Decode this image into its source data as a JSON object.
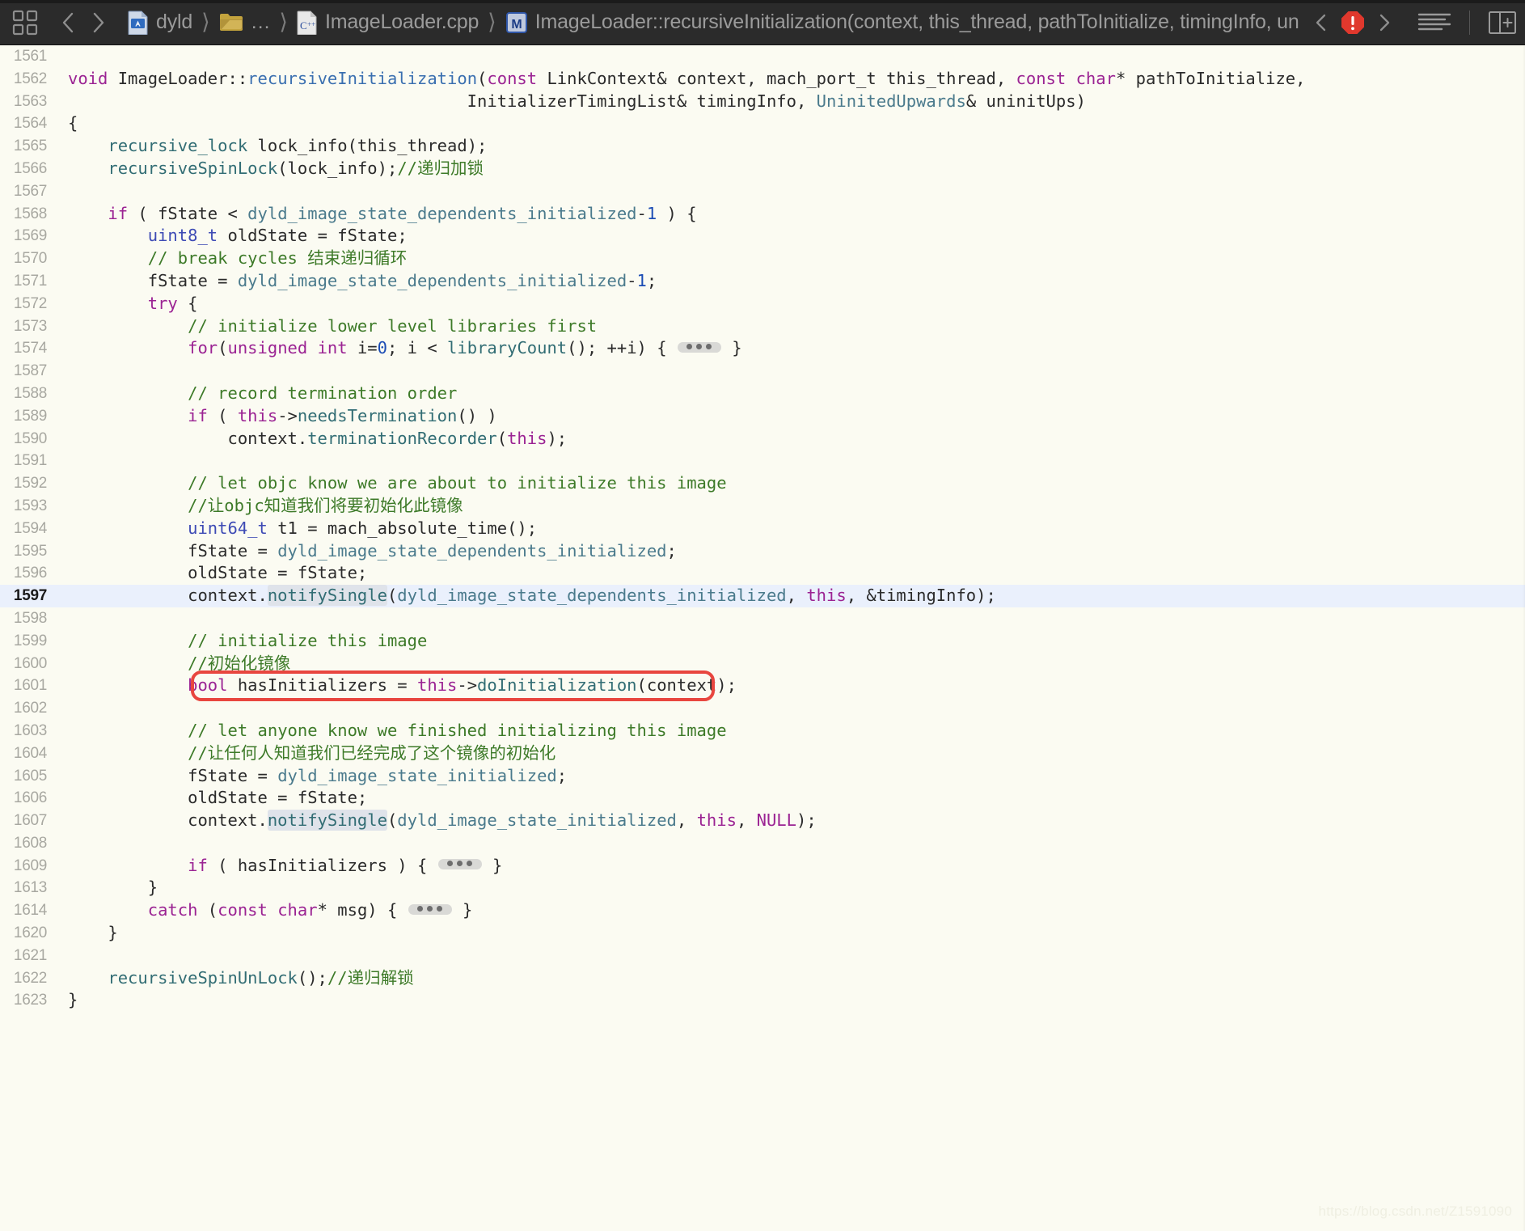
{
  "window": {
    "app": "Xcode",
    "background": "#fbfbf2",
    "toolbar_background": "#2b2b2b",
    "highlight_line_color": "#eaf0fc",
    "annotation_box_color": "#e8463f"
  },
  "toolbar": {
    "grid_icon": "grid-icon",
    "back_label": "‹",
    "forward_label": "›",
    "breadcrumb": [
      {
        "icon": "project-document-icon",
        "label": "dyld"
      },
      {
        "icon": "folder-icon",
        "label": "…"
      },
      {
        "icon": "cpp-source-file-icon",
        "label": "ImageLoader.cpp"
      },
      {
        "icon": "method-symbol-icon",
        "label": "ImageLoader::recursiveInitialization(context, this_thread, pathToInitialize, timingInfo, uninitUps)"
      }
    ],
    "issue_prev_label": "‹",
    "issue_next_label": "›",
    "issue_badge": "error-stop-icon",
    "minimap_icon": "document-lines-icon",
    "assistant_icon": "split-editor-icon"
  },
  "editor": {
    "selected_symbol": "notifySingle",
    "highlighted_line": "1597",
    "annotated_line": "1601",
    "lines": [
      {
        "n": "1561",
        "tokens": []
      },
      {
        "n": "1562",
        "tokens": [
          {
            "t": "void",
            "c": "t-kw"
          },
          {
            "t": " ImageLoader::",
            "c": "t-dark"
          },
          {
            "t": "recursiveInitialization",
            "c": "t-fndef"
          },
          {
            "t": "(",
            "c": "t-dark"
          },
          {
            "t": "const",
            "c": "t-kw"
          },
          {
            "t": " LinkContext& context, mach_port_t this_thread, ",
            "c": "t-dark"
          },
          {
            "t": "const",
            "c": "t-kw"
          },
          {
            "t": " ",
            "c": "t-dark"
          },
          {
            "t": "char",
            "c": "t-kw"
          },
          {
            "t": "* pathToInitialize,",
            "c": "t-dark"
          }
        ]
      },
      {
        "n": "1563",
        "tokens": [
          {
            "t": "                                        InitializerTimingList",
            "c": "t-dark"
          },
          {
            "t": "& timingInfo, ",
            "c": "t-dark"
          },
          {
            "t": "UninitedUpwards",
            "c": "t-const"
          },
          {
            "t": "& uninitUps)",
            "c": "t-dark"
          }
        ]
      },
      {
        "n": "1564",
        "tokens": [
          {
            "t": "{",
            "c": "t-dark"
          }
        ]
      },
      {
        "n": "1565",
        "tokens": [
          {
            "t": "    ",
            "c": "t-dark"
          },
          {
            "t": "recursive_lock",
            "c": "t-fn"
          },
          {
            "t": " lock_info(this_thread);",
            "c": "t-dark"
          }
        ]
      },
      {
        "n": "1566",
        "tokens": [
          {
            "t": "    ",
            "c": "t-dark"
          },
          {
            "t": "recursiveSpinLock",
            "c": "t-fn"
          },
          {
            "t": "(lock_info);",
            "c": "t-dark"
          },
          {
            "t": "//递归加锁",
            "c": "t-cmt"
          }
        ]
      },
      {
        "n": "1567",
        "tokens": []
      },
      {
        "n": "1568",
        "tokens": [
          {
            "t": "    ",
            "c": "t-dark"
          },
          {
            "t": "if",
            "c": "t-kw"
          },
          {
            "t": " ( fState < ",
            "c": "t-dark"
          },
          {
            "t": "dyld_image_state_dependents_initialized",
            "c": "t-const"
          },
          {
            "t": "-",
            "c": "t-dark"
          },
          {
            "t": "1",
            "c": "t-num"
          },
          {
            "t": " ) {",
            "c": "t-dark"
          }
        ]
      },
      {
        "n": "1569",
        "tokens": [
          {
            "t": "        ",
            "c": "t-dark"
          },
          {
            "t": "uint8_t",
            "c": "t-type"
          },
          {
            "t": " oldState = fState;",
            "c": "t-dark"
          }
        ]
      },
      {
        "n": "1570",
        "tokens": [
          {
            "t": "        ",
            "c": "t-dark"
          },
          {
            "t": "// break cycles 结束递归循环",
            "c": "t-cmt"
          }
        ]
      },
      {
        "n": "1571",
        "tokens": [
          {
            "t": "        fState = ",
            "c": "t-dark"
          },
          {
            "t": "dyld_image_state_dependents_initialized",
            "c": "t-const"
          },
          {
            "t": "-",
            "c": "t-dark"
          },
          {
            "t": "1",
            "c": "t-num"
          },
          {
            "t": ";",
            "c": "t-dark"
          }
        ]
      },
      {
        "n": "1572",
        "tokens": [
          {
            "t": "        ",
            "c": "t-dark"
          },
          {
            "t": "try",
            "c": "t-kw"
          },
          {
            "t": " {",
            "c": "t-dark"
          }
        ]
      },
      {
        "n": "1573",
        "tokens": [
          {
            "t": "            ",
            "c": "t-dark"
          },
          {
            "t": "// initialize lower level libraries first",
            "c": "t-cmt"
          }
        ]
      },
      {
        "n": "1574",
        "tokens": [
          {
            "t": "            ",
            "c": "t-dark"
          },
          {
            "t": "for",
            "c": "t-kw"
          },
          {
            "t": "(",
            "c": "t-dark"
          },
          {
            "t": "unsigned",
            "c": "t-kw"
          },
          {
            "t": " ",
            "c": "t-dark"
          },
          {
            "t": "int",
            "c": "t-kw"
          },
          {
            "t": " i=",
            "c": "t-dark"
          },
          {
            "t": "0",
            "c": "t-num"
          },
          {
            "t": "; i < ",
            "c": "t-dark"
          },
          {
            "t": "libraryCount",
            "c": "t-fn"
          },
          {
            "t": "(); ++i) { ",
            "c": "t-dark"
          },
          {
            "t": "…FOLD…",
            "c": "fold"
          },
          {
            "t": " }",
            "c": "t-dark"
          }
        ]
      },
      {
        "n": "1587",
        "tokens": []
      },
      {
        "n": "1588",
        "tokens": [
          {
            "t": "            ",
            "c": "t-dark"
          },
          {
            "t": "// record termination order",
            "c": "t-cmt"
          }
        ]
      },
      {
        "n": "1589",
        "tokens": [
          {
            "t": "            ",
            "c": "t-dark"
          },
          {
            "t": "if",
            "c": "t-kw"
          },
          {
            "t": " ( ",
            "c": "t-dark"
          },
          {
            "t": "this",
            "c": "t-kw"
          },
          {
            "t": "->",
            "c": "t-dark"
          },
          {
            "t": "needsTermination",
            "c": "t-fn"
          },
          {
            "t": "() )",
            "c": "t-dark"
          }
        ]
      },
      {
        "n": "1590",
        "tokens": [
          {
            "t": "                context.",
            "c": "t-dark"
          },
          {
            "t": "terminationRecorder",
            "c": "t-fn"
          },
          {
            "t": "(",
            "c": "t-dark"
          },
          {
            "t": "this",
            "c": "t-kw"
          },
          {
            "t": ");",
            "c": "t-dark"
          }
        ]
      },
      {
        "n": "1591",
        "tokens": []
      },
      {
        "n": "1592",
        "tokens": [
          {
            "t": "            ",
            "c": "t-dark"
          },
          {
            "t": "// let objc know we are about to initialize this image",
            "c": "t-cmt"
          }
        ]
      },
      {
        "n": "1593",
        "tokens": [
          {
            "t": "            ",
            "c": "t-dark"
          },
          {
            "t": "//让objc知道我们将要初始化此镜像",
            "c": "t-cmt"
          }
        ]
      },
      {
        "n": "1594",
        "tokens": [
          {
            "t": "            ",
            "c": "t-dark"
          },
          {
            "t": "uint64_t",
            "c": "t-type"
          },
          {
            "t": " t1 = mach_absolute_time();",
            "c": "t-dark"
          }
        ]
      },
      {
        "n": "1595",
        "tokens": [
          {
            "t": "            fState = ",
            "c": "t-dark"
          },
          {
            "t": "dyld_image_state_dependents_initialized",
            "c": "t-const"
          },
          {
            "t": ";",
            "c": "t-dark"
          }
        ]
      },
      {
        "n": "1596",
        "tokens": [
          {
            "t": "            oldState = fState;",
            "c": "t-dark"
          }
        ]
      },
      {
        "n": "1597",
        "hl": true,
        "tokens": [
          {
            "t": "            context.",
            "c": "t-dark"
          },
          {
            "t": "notifySingle",
            "c": "t-fn t-sel"
          },
          {
            "t": "(",
            "c": "t-dark"
          },
          {
            "t": "dyld_image_state_dependents_initialized",
            "c": "t-const"
          },
          {
            "t": ", ",
            "c": "t-dark"
          },
          {
            "t": "this",
            "c": "t-kw"
          },
          {
            "t": ", &timingInfo);",
            "c": "t-dark"
          }
        ]
      },
      {
        "n": "1598",
        "tokens": []
      },
      {
        "n": "1599",
        "tokens": [
          {
            "t": "            ",
            "c": "t-dark"
          },
          {
            "t": "// initialize this image",
            "c": "t-cmt"
          }
        ]
      },
      {
        "n": "1600",
        "tokens": [
          {
            "t": "            ",
            "c": "t-dark"
          },
          {
            "t": "//初始化镜像",
            "c": "t-cmt"
          }
        ]
      },
      {
        "n": "1601",
        "box": true,
        "tokens": [
          {
            "t": "            ",
            "c": "t-dark"
          },
          {
            "t": "bool",
            "c": "t-kw"
          },
          {
            "t": " hasInitializers = ",
            "c": "t-dark"
          },
          {
            "t": "this",
            "c": "t-kw"
          },
          {
            "t": "->",
            "c": "t-dark"
          },
          {
            "t": "doInitialization",
            "c": "t-fn"
          },
          {
            "t": "(context);",
            "c": "t-dark"
          }
        ]
      },
      {
        "n": "1602",
        "tokens": []
      },
      {
        "n": "1603",
        "tokens": [
          {
            "t": "            ",
            "c": "t-dark"
          },
          {
            "t": "// let anyone know we finished initializing this image",
            "c": "t-cmt"
          }
        ]
      },
      {
        "n": "1604",
        "tokens": [
          {
            "t": "            ",
            "c": "t-dark"
          },
          {
            "t": "//让任何人知道我们已经完成了这个镜像的初始化",
            "c": "t-cmt"
          }
        ]
      },
      {
        "n": "1605",
        "tokens": [
          {
            "t": "            fState = ",
            "c": "t-dark"
          },
          {
            "t": "dyld_image_state_initialized",
            "c": "t-const"
          },
          {
            "t": ";",
            "c": "t-dark"
          }
        ]
      },
      {
        "n": "1606",
        "tokens": [
          {
            "t": "            oldState = fState;",
            "c": "t-dark"
          }
        ]
      },
      {
        "n": "1607",
        "tokens": [
          {
            "t": "            context.",
            "c": "t-dark"
          },
          {
            "t": "notifySingle",
            "c": "t-fn t-sel"
          },
          {
            "t": "(",
            "c": "t-dark"
          },
          {
            "t": "dyld_image_state_initialized",
            "c": "t-const"
          },
          {
            "t": ", ",
            "c": "t-dark"
          },
          {
            "t": "this",
            "c": "t-kw"
          },
          {
            "t": ", ",
            "c": "t-dark"
          },
          {
            "t": "NULL",
            "c": "t-kw"
          },
          {
            "t": ");",
            "c": "t-dark"
          }
        ]
      },
      {
        "n": "1608",
        "tokens": []
      },
      {
        "n": "1609",
        "tokens": [
          {
            "t": "            ",
            "c": "t-dark"
          },
          {
            "t": "if",
            "c": "t-kw"
          },
          {
            "t": " ( hasInitializers ) { ",
            "c": "t-dark"
          },
          {
            "t": "…FOLD…",
            "c": "fold"
          },
          {
            "t": " }",
            "c": "t-dark"
          }
        ]
      },
      {
        "n": "1613",
        "tokens": [
          {
            "t": "        }",
            "c": "t-dark"
          }
        ]
      },
      {
        "n": "1614",
        "tokens": [
          {
            "t": "        ",
            "c": "t-dark"
          },
          {
            "t": "catch",
            "c": "t-kw"
          },
          {
            "t": " (",
            "c": "t-dark"
          },
          {
            "t": "const",
            "c": "t-kw"
          },
          {
            "t": " ",
            "c": "t-dark"
          },
          {
            "t": "char",
            "c": "t-kw"
          },
          {
            "t": "* msg) { ",
            "c": "t-dark"
          },
          {
            "t": "…FOLD…",
            "c": "fold"
          },
          {
            "t": " }",
            "c": "t-dark"
          }
        ]
      },
      {
        "n": "1620",
        "tokens": [
          {
            "t": "    }",
            "c": "t-dark"
          }
        ]
      },
      {
        "n": "1621",
        "tokens": []
      },
      {
        "n": "1622",
        "tokens": [
          {
            "t": "    ",
            "c": "t-dark"
          },
          {
            "t": "recursiveSpinUnLock",
            "c": "t-fn"
          },
          {
            "t": "();",
            "c": "t-dark"
          },
          {
            "t": "//递归解锁",
            "c": "t-cmt"
          }
        ]
      },
      {
        "n": "1623",
        "tokens": [
          {
            "t": "}",
            "c": "t-dark"
          }
        ]
      }
    ]
  },
  "watermark": {
    "text": "https://blog.csdn.net/Z1591090"
  }
}
